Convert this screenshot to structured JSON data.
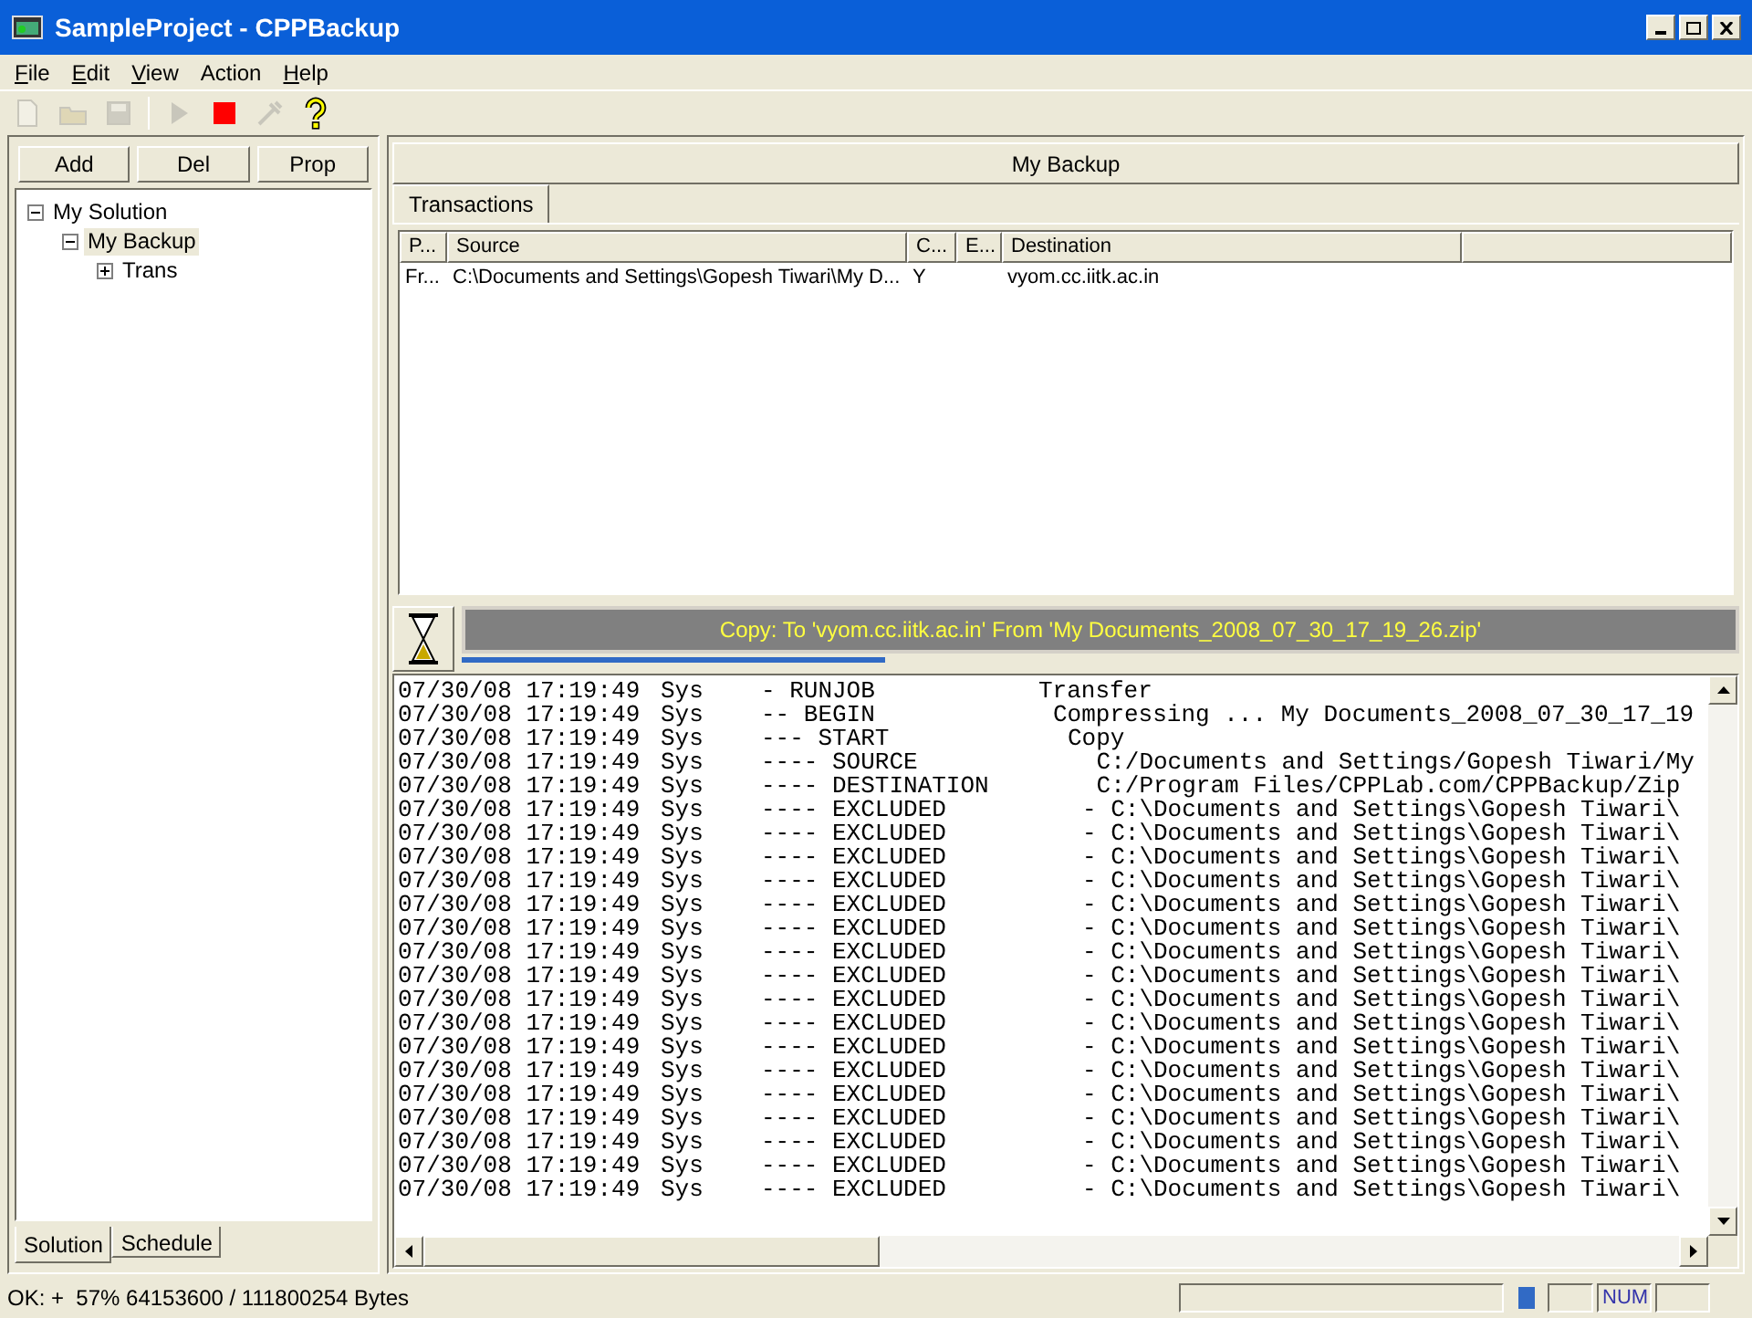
{
  "window": {
    "title": "SampleProject - CPPBackup"
  },
  "menu": [
    {
      "label": "File",
      "mnemonic": true
    },
    {
      "label": "Edit",
      "mnemonic": true
    },
    {
      "label": "View",
      "mnemonic": true
    },
    {
      "label": "Action",
      "mnemonic": false
    },
    {
      "label": "Help",
      "mnemonic": true
    }
  ],
  "toolbar": [
    {
      "kind": "new",
      "disabled": true
    },
    {
      "kind": "open",
      "disabled": true
    },
    {
      "kind": "save",
      "disabled": true
    },
    {
      "kind": "separator"
    },
    {
      "kind": "run",
      "disabled": true
    },
    {
      "kind": "stop",
      "disabled": false
    },
    {
      "kind": "tool",
      "disabled": true
    },
    {
      "kind": "help",
      "disabled": false
    }
  ],
  "solution_panel": {
    "buttons": [
      "Add",
      "Del",
      "Prop"
    ],
    "tree": [
      {
        "label": "My Solution",
        "expanded": true,
        "selected": false,
        "children": [
          {
            "label": "My Backup",
            "expanded": true,
            "selected": true,
            "children": [
              {
                "label": "Trans",
                "expanded": false,
                "selected": false
              }
            ]
          }
        ]
      }
    ],
    "tabs": [
      {
        "label": "Solution",
        "selected": true
      },
      {
        "label": "Schedule",
        "selected": false
      }
    ]
  },
  "backup_panel": {
    "header": "My Backup",
    "tabs": [
      {
        "label": "Transactions",
        "selected": true
      }
    ],
    "table": {
      "columns": [
        "P...",
        "Source",
        "C...",
        "E...",
        "Destination"
      ],
      "rows": [
        {
          "p": "Fr...",
          "source": "C:\\Documents and Settings\\Gopesh Tiwari\\My D...",
          "c": "Y",
          "destination": "vyom.cc.iitk.ac.in"
        }
      ]
    },
    "progress": {
      "message": "Copy: To 'vyom.cc.iitk.ac.in' From 'My Documents_2008_07_30_17_19_26.zip'"
    },
    "log": [
      {
        "time": "07/30/08 17:19:49",
        "source": "Sys",
        "event": "- RUNJOB",
        "detail": "Transfer"
      },
      {
        "time": "07/30/08 17:19:49",
        "source": "Sys",
        "event": "-- BEGIN",
        "detail": "Compressing ... My Documents_2008_07_30_17_19"
      },
      {
        "time": "07/30/08 17:19:49",
        "source": "Sys",
        "event": "--- START",
        "detail": "Copy"
      },
      {
        "time": "07/30/08 17:19:49",
        "source": "Sys",
        "event": "---- SOURCE",
        "detail": " C:/Documents and Settings/Gopesh Tiwari/My"
      },
      {
        "time": "07/30/08 17:19:49",
        "source": "Sys",
        "event": "---- DESTINATION",
        "detail": " C:/Program Files/CPPLab.com/CPPBackup/Zip"
      },
      {
        "time": "07/30/08 17:19:49",
        "source": "Sys",
        "event": "---- EXCLUDED",
        "detail": "- C:\\Documents and Settings\\Gopesh Tiwari\\"
      },
      {
        "time": "07/30/08 17:19:49",
        "source": "Sys",
        "event": "---- EXCLUDED",
        "detail": "- C:\\Documents and Settings\\Gopesh Tiwari\\"
      },
      {
        "time": "07/30/08 17:19:49",
        "source": "Sys",
        "event": "---- EXCLUDED",
        "detail": "- C:\\Documents and Settings\\Gopesh Tiwari\\"
      },
      {
        "time": "07/30/08 17:19:49",
        "source": "Sys",
        "event": "---- EXCLUDED",
        "detail": "- C:\\Documents and Settings\\Gopesh Tiwari\\"
      },
      {
        "time": "07/30/08 17:19:49",
        "source": "Sys",
        "event": "---- EXCLUDED",
        "detail": "- C:\\Documents and Settings\\Gopesh Tiwari\\"
      },
      {
        "time": "07/30/08 17:19:49",
        "source": "Sys",
        "event": "---- EXCLUDED",
        "detail": "- C:\\Documents and Settings\\Gopesh Tiwari\\"
      },
      {
        "time": "07/30/08 17:19:49",
        "source": "Sys",
        "event": "---- EXCLUDED",
        "detail": "- C:\\Documents and Settings\\Gopesh Tiwari\\"
      },
      {
        "time": "07/30/08 17:19:49",
        "source": "Sys",
        "event": "---- EXCLUDED",
        "detail": "- C:\\Documents and Settings\\Gopesh Tiwari\\"
      },
      {
        "time": "07/30/08 17:19:49",
        "source": "Sys",
        "event": "---- EXCLUDED",
        "detail": "- C:\\Documents and Settings\\Gopesh Tiwari\\"
      },
      {
        "time": "07/30/08 17:19:49",
        "source": "Sys",
        "event": "---- EXCLUDED",
        "detail": "- C:\\Documents and Settings\\Gopesh Tiwari\\"
      },
      {
        "time": "07/30/08 17:19:49",
        "source": "Sys",
        "event": "---- EXCLUDED",
        "detail": "- C:\\Documents and Settings\\Gopesh Tiwari\\"
      },
      {
        "time": "07/30/08 17:19:49",
        "source": "Sys",
        "event": "---- EXCLUDED",
        "detail": "- C:\\Documents and Settings\\Gopesh Tiwari\\"
      },
      {
        "time": "07/30/08 17:19:49",
        "source": "Sys",
        "event": "---- EXCLUDED",
        "detail": "- C:\\Documents and Settings\\Gopesh Tiwari\\"
      },
      {
        "time": "07/30/08 17:19:49",
        "source": "Sys",
        "event": "---- EXCLUDED",
        "detail": "- C:\\Documents and Settings\\Gopesh Tiwari\\"
      },
      {
        "time": "07/30/08 17:19:49",
        "source": "Sys",
        "event": "---- EXCLUDED",
        "detail": "- C:\\Documents and Settings\\Gopesh Tiwari\\"
      },
      {
        "time": "07/30/08 17:19:49",
        "source": "Sys",
        "event": "---- EXCLUDED",
        "detail": "- C:\\Documents and Settings\\Gopesh Tiwari\\"
      },
      {
        "time": "07/30/08 17:19:49",
        "source": "Sys",
        "event": "---- EXCLUDED",
        "detail": "- C:\\Documents and Settings\\Gopesh Tiwari\\"
      }
    ]
  },
  "status_bar": {
    "message": "OK: +  57% 64153600 / 111800254 Bytes",
    "indicator": "NUM"
  }
}
